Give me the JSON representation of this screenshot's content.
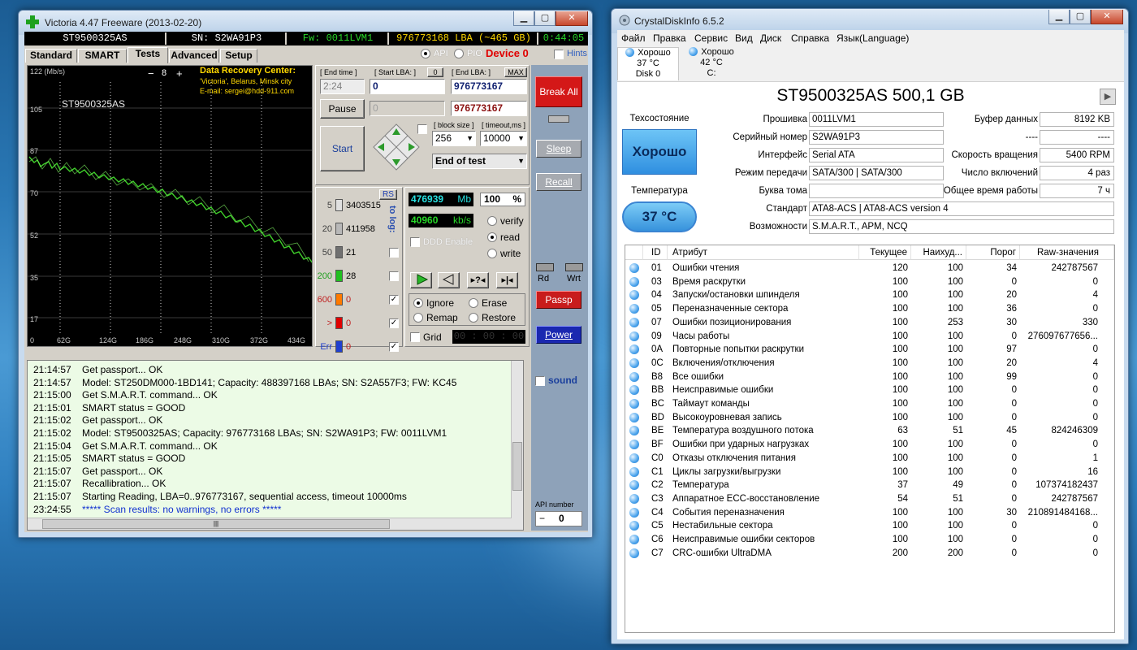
{
  "victoria": {
    "title": "Victoria 4.47  Freeware (2013-02-20)",
    "infobar": {
      "model": "ST9500325AS",
      "serial": "SN: S2WA91P3",
      "firmware": "Fw: 0011LVM1",
      "lba": "976773168 LBA (~465 GB)",
      "clock": "0:44:05"
    },
    "tabs": [
      "Standard",
      "SMART",
      "Tests",
      "Advanced",
      "Setup"
    ],
    "api_label": "API",
    "pio_label": "PIO",
    "device_label": "Device 0",
    "hints_label": "Hints",
    "graph": {
      "scale_top": "122 (Mb/s)",
      "scale_value": "8",
      "model": "ST9500325AS",
      "y_ticks": [
        "105",
        "87",
        "70",
        "52",
        "35",
        "17",
        "0"
      ],
      "x_ticks": [
        "62G",
        "124G",
        "186G",
        "248G",
        "310G",
        "372G",
        "434G"
      ],
      "recovery_title": "Data Recovery Center:",
      "recovery_line2": "'Victoria', Belarus, Minsk city",
      "recovery_line3": "E-mail: sergei@hdd-911.com"
    },
    "controls": {
      "end_time_label": "[ End time ]",
      "end_time_value": "2:24",
      "start_lba_label": "[ Start LBA: ]",
      "start_lba_chip": "0",
      "start_lba_value": "0",
      "end_lba_label": "[ End LBA: ]",
      "end_lba_max": "MAX",
      "end_lba_value": "976773167",
      "cur_lba_value": "976773167",
      "second_field": "0",
      "pause_label": "Pause",
      "start_label": "Start",
      "block_size_label": "[ block size ]",
      "block_size_value": "256",
      "timeout_label": "[ timeout,ms ]",
      "timeout_value": "10000",
      "end_of_test": "End of test"
    },
    "counters": [
      {
        "ms": "5",
        "count": "3403515",
        "color": "#e0e0e0"
      },
      {
        "ms": "20",
        "count": "411958",
        "color": "#b8b8b8"
      },
      {
        "ms": "50",
        "count": "21",
        "color": "#707070"
      },
      {
        "ms": "200",
        "count": "28",
        "color": "#20c020"
      },
      {
        "ms": "600",
        "count": "0",
        "color": "#ff7a00"
      },
      {
        "ms": ">",
        "count": "0",
        "color": "#e00000"
      },
      {
        "ms": "Err",
        "count": "0",
        "color": "#2040d0"
      }
    ],
    "rs_label": "RS",
    "to_log": "to log:",
    "speed": {
      "mb_value": "476939",
      "mb_unit": "Mb",
      "percent": "100",
      "percent_unit": "%",
      "kbs_value": "40960",
      "kbs_unit": "kb/s",
      "ddd_label": "DDD Enable"
    },
    "modes": {
      "verify": "verify",
      "read": "read",
      "write": "write"
    },
    "actions": {
      "ignore": "Ignore",
      "erase": "Erase",
      "remap": "Remap",
      "restore": "Restore"
    },
    "grid_label": "Grid",
    "grid_time": "00 : 00 : 00",
    "side": {
      "break_all": "Break All",
      "sleep": "Sleep",
      "recall": "Recall",
      "rd": "Rd",
      "wrt": "Wrt",
      "passp": "Passp",
      "power": "Power",
      "sound": "sound",
      "api_number": "API number",
      "api_value": "0"
    },
    "log": [
      {
        "t": "21:14:57",
        "m": "Get passport... OK"
      },
      {
        "t": "21:14:57",
        "m": "Model: ST250DM000-1BD141; Capacity: 488397168 LBAs; SN: S2A557F3; FW: KC45"
      },
      {
        "t": "21:15:00",
        "m": "Get S.M.A.R.T. command... OK"
      },
      {
        "t": "21:15:01",
        "m": "SMART status = GOOD"
      },
      {
        "t": "21:15:02",
        "m": "Get passport... OK"
      },
      {
        "t": "21:15:02",
        "m": "Model: ST9500325AS; Capacity: 976773168 LBAs; SN: S2WA91P3; FW: 0011LVM1"
      },
      {
        "t": "21:15:04",
        "m": "Get S.M.A.R.T. command... OK"
      },
      {
        "t": "21:15:05",
        "m": "SMART status = GOOD"
      },
      {
        "t": "21:15:07",
        "m": "Get passport... OK"
      },
      {
        "t": "21:15:07",
        "m": "Recallibration... OK"
      },
      {
        "t": "21:15:07",
        "m": "Starting Reading, LBA=0..976773167, sequential access, timeout 10000ms"
      },
      {
        "t": "23:24:55",
        "m": "***** Scan results: no warnings, no errors *****",
        "blue": true
      }
    ]
  },
  "crystal": {
    "title": "CrystalDiskInfo 6.5.2",
    "menu": [
      "Файл",
      "Правка",
      "Сервис",
      "Вид",
      "Диск",
      "Справка",
      "Язык(Language)"
    ],
    "disks": [
      {
        "status": "Хорошо",
        "temp": "37 °C",
        "name": "Disk 0"
      },
      {
        "status": "Хорошо",
        "temp": "42 °C",
        "name": "C:"
      }
    ],
    "heading": "ST9500325AS 500,1 GB",
    "health_label": "Техсостояние",
    "health_value": "Хорошо",
    "temp_label": "Температура",
    "temp_value": "37 °C",
    "fields": {
      "firmware_label": "Прошивка",
      "firmware": "0011LVM1",
      "serial_label": "Серийный номер",
      "serial": "S2WA91P3",
      "interface_label": "Интерфейс",
      "interface": "Serial ATA",
      "transfer_label": "Режим передачи",
      "transfer": "SATA/300 | SATA/300",
      "volume_label": "Буква тома",
      "volume": "",
      "standard_label": "Стандарт",
      "standard": "ATA8-ACS | ATA8-ACS version 4",
      "features_label": "Возможности",
      "features": "S.M.A.R.T., APM, NCQ",
      "buffer_label": "Буфер данных",
      "buffer": "8192 KB",
      "blank_label": "----",
      "blank": "----",
      "rpm_label": "Скорость вращения",
      "rpm": "5400 RPM",
      "poweron_count_label": "Число включений",
      "poweron_count": "4 раз",
      "hours_label": "Общее время работы",
      "hours": "7 ч"
    },
    "table_headers": [
      "ID",
      "Атрибут",
      "Текущее",
      "Наихуд...",
      "Порог",
      "Raw-значения"
    ],
    "rows": [
      [
        "01",
        "Ошибки чтения",
        "120",
        "100",
        "34",
        "242787567"
      ],
      [
        "03",
        "Время раскрутки",
        "100",
        "100",
        "0",
        "0"
      ],
      [
        "04",
        "Запуски/остановки шпинделя",
        "100",
        "100",
        "20",
        "4"
      ],
      [
        "05",
        "Переназначенные сектора",
        "100",
        "100",
        "36",
        "0"
      ],
      [
        "07",
        "Ошибки позиционирования",
        "100",
        "253",
        "30",
        "330"
      ],
      [
        "09",
        "Часы работы",
        "100",
        "100",
        "0",
        "276097677656..."
      ],
      [
        "0A",
        "Повторные попытки раскрутки",
        "100",
        "100",
        "97",
        "0"
      ],
      [
        "0C",
        "Включения/отключения",
        "100",
        "100",
        "20",
        "4"
      ],
      [
        "B8",
        "Все ошибки",
        "100",
        "100",
        "99",
        "0"
      ],
      [
        "BB",
        "Неисправимые ошибки",
        "100",
        "100",
        "0",
        "0"
      ],
      [
        "BC",
        "Таймаут команды",
        "100",
        "100",
        "0",
        "0"
      ],
      [
        "BD",
        "Высокоуровневая запись",
        "100",
        "100",
        "0",
        "0"
      ],
      [
        "BE",
        "Температура воздушного потока",
        "63",
        "51",
        "45",
        "824246309"
      ],
      [
        "BF",
        "Ошибки при ударных нагрузках",
        "100",
        "100",
        "0",
        "0"
      ],
      [
        "C0",
        "Отказы отключения питания",
        "100",
        "100",
        "0",
        "1"
      ],
      [
        "C1",
        "Циклы загрузки/выгрузки",
        "100",
        "100",
        "0",
        "16"
      ],
      [
        "C2",
        "Температура",
        "37",
        "49",
        "0",
        "107374182437"
      ],
      [
        "C3",
        "Аппаратное ECC-восстановление",
        "54",
        "51",
        "0",
        "242787567"
      ],
      [
        "C4",
        "События переназначения",
        "100",
        "100",
        "30",
        "210891484168..."
      ],
      [
        "C5",
        "Нестабильные сектора",
        "100",
        "100",
        "0",
        "0"
      ],
      [
        "C6",
        "Неисправимые ошибки секторов",
        "100",
        "100",
        "0",
        "0"
      ],
      [
        "C7",
        "CRC-ошибки UltraDMA",
        "200",
        "200",
        "0",
        "0"
      ]
    ]
  }
}
